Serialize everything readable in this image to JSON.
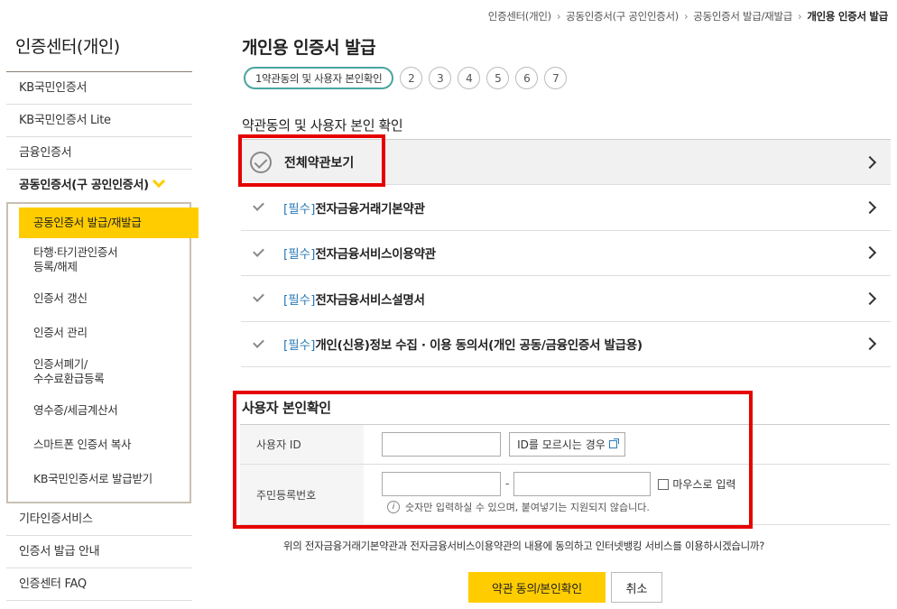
{
  "breadcrumb": [
    "인증센터(개인)",
    "공동인증서(구 공인인증서)",
    "공동인증서 발급/재발급",
    "개인용 인증서 발급"
  ],
  "sidebar": {
    "title": "인증센터(개인)",
    "items_top": [
      "KB국민인증서",
      "KB국민인증서 Lite",
      "금융인증서",
      "공동인증서(구 공인인증서)"
    ],
    "sub_items": [
      "공동인증서 발급/재발급",
      "타행·타기관인증서\n등록/해제",
      "인증서 갱신",
      "인증서 관리",
      "인증서폐기/\n수수료환급등록",
      "영수증/세금계산서",
      "스마트폰 인증서 복사",
      "KB국민인증서로 발급받기"
    ],
    "items_bottom": [
      "기타인증서비스",
      "인증서 발급 안내",
      "인증센터 FAQ"
    ]
  },
  "main": {
    "title": "개인용 인증서 발급",
    "steps": [
      "1약관동의 및 사용자 본인확인",
      "2",
      "3",
      "4",
      "5",
      "6",
      "7"
    ],
    "section_title": "약관동의 및 사용자 본인 확인",
    "terms_all": "전체약관보기",
    "terms": [
      {
        "req": "[필수]",
        "label": "전자금융거래기본약관"
      },
      {
        "req": "[필수]",
        "label": "전자금융서비스이용약관"
      },
      {
        "req": "[필수]",
        "label": "전자금융서비스설명서"
      },
      {
        "req": "[필수]",
        "label": "개인(신용)정보 수집 · 이용 동의서(개인 공동/금융인증서 발급용)"
      }
    ],
    "verify": {
      "title": "사용자 본인확인",
      "id_label": "사용자 ID",
      "id_forgot": "ID를 모르시는 경우",
      "rrn_label": "주민등록번호",
      "dash": "-",
      "mouse_input": "마우스로 입력",
      "hint": "숫자만 입력하실 수 있으며, 붙여넣기는 지원되지 않습니다."
    },
    "question": "위의 전자금융거래기본약관과 전자금융서비스이용약관의 내용에 동의하고 인터넷뱅킹 서비스를 이용하시겠습니까?",
    "agree_button": "약관 동의/본인확인",
    "cancel_button": "취소"
  }
}
